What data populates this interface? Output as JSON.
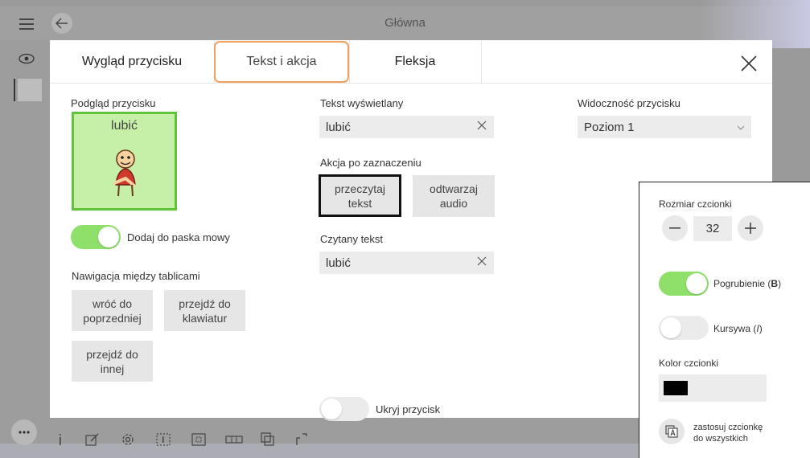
{
  "app": {
    "title": "Główna"
  },
  "tabs": [
    {
      "label": "Wygląd przycisku"
    },
    {
      "label": "Tekst i akcja"
    },
    {
      "label": "Fleksja"
    }
  ],
  "preview": {
    "label": "Podgląd przycisku",
    "word": "lubić",
    "bg_color": "#c6f0a8",
    "border_color": "#5fc43a"
  },
  "speech_bar": {
    "label": "Dodaj do paska mowy",
    "checked": true
  },
  "navigation": {
    "label": "Nawigacja między tablicami",
    "buttons": [
      {
        "label": "wróć do\npoprzedniej"
      },
      {
        "label": "przejdź do\nklawiatur"
      },
      {
        "label": "przejdź do\ninnej"
      }
    ]
  },
  "display_text": {
    "label": "Tekst wyświetlany",
    "value": "lubić"
  },
  "action": {
    "label": "Akcja po zaznaczeniu",
    "options": [
      {
        "label": "przeczytaj\ntekst",
        "selected": true
      },
      {
        "label": "odtwarzaj\naudio",
        "selected": false
      }
    ]
  },
  "read_text": {
    "label": "Czytany tekst",
    "value": "lubić"
  },
  "hide_button": {
    "label": "Ukryj przycisk",
    "checked": false
  },
  "visibility": {
    "label": "Widoczność przycisku",
    "value": "Poziom 1"
  },
  "font_panel": {
    "size_label": "Rozmiar czcionki",
    "size_value": "32",
    "bold_label": "Pogrubienie (",
    "bold_key": "B",
    "bold_end": ")",
    "bold_checked": true,
    "italic_label": "Kursywa (",
    "italic_key": "I",
    "italic_end": ")",
    "italic_checked": false,
    "color_label": "Kolor czcionki",
    "color_value": "#000000",
    "apply_label_1": "zastosuj czcionkę",
    "apply_label_2": "do wszystkich"
  },
  "icons": {
    "menu": "hamburger-icon",
    "back": "back-arrow-icon",
    "eye": "eye-icon",
    "close": "close-icon",
    "clear": "clear-x-icon",
    "dropdown": "chevron-down-icon",
    "minus": "minus-icon",
    "plus": "plus-icon",
    "apply": "apply-font-icon"
  }
}
